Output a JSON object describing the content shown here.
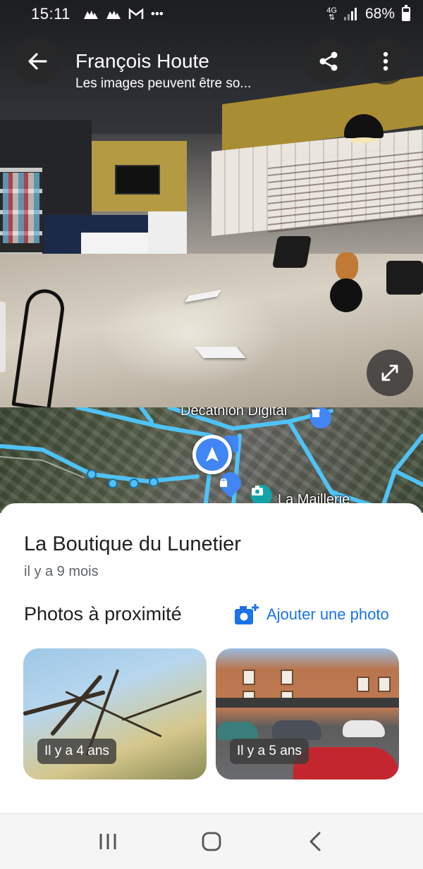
{
  "status_bar": {
    "time": "15:11",
    "network": "4G",
    "battery": "68%",
    "notification_icons": [
      "signal-bars-icon",
      "signal-bars-icon",
      "gmail-icon",
      "more-dots-icon"
    ]
  },
  "header": {
    "title": "François Houte",
    "subtitle": "Les images peuvent être so..."
  },
  "map": {
    "labels": [
      "Decathlon Digital",
      "La Maillerie"
    ]
  },
  "sheet": {
    "place_title": "La Boutique du Lunetier",
    "place_date": "il y a 9 mois",
    "nearby_title": "Photos à proximité",
    "add_photo_label": "Ajouter une photo",
    "photos": [
      {
        "label": "Il y a 4 ans"
      },
      {
        "label": "Il y a 5 ans"
      }
    ]
  },
  "colors": {
    "accent": "#1a73e8",
    "map_route": "#4fc3f7",
    "location_pin": "#4285f4",
    "poi_teal": "#12a4a8",
    "poi_blue": "#4285f4"
  }
}
